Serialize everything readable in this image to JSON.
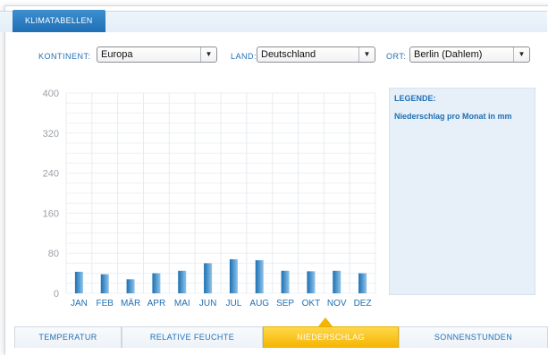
{
  "window": {
    "title_tab": "KLIMATABELLEN"
  },
  "filters": {
    "continent_label": "KONTINENT:",
    "continent_value": "Europa",
    "country_label": "LAND:",
    "country_value": "Deutschland",
    "location_label": "ORT:",
    "location_value": "Berlin (Dahlem)"
  },
  "legend": {
    "title": "LEGENDE:",
    "item": "Niederschlag pro Monat in mm"
  },
  "tabs": [
    {
      "label": "TEMPERATUR",
      "active": false
    },
    {
      "label": "RELATIVE FEUCHTE",
      "active": false
    },
    {
      "label": "NIEDERSCHLAG",
      "active": true
    },
    {
      "label": "SONNENSTUNDEN",
      "active": false
    }
  ],
  "colors": {
    "accent": "#1f6fb4",
    "bar_top": "#1b6fb2",
    "bar_bottom": "#8fc4ea",
    "active_tab": "#f5b400"
  },
  "chart_data": {
    "type": "bar",
    "categories": [
      "JAN",
      "FEB",
      "MÄR",
      "APR",
      "MAI",
      "JUN",
      "JUL",
      "AUG",
      "SEP",
      "OKT",
      "NOV",
      "DEZ"
    ],
    "values": [
      43,
      38,
      28,
      40,
      45,
      60,
      68,
      66,
      45,
      44,
      45,
      40
    ],
    "yticks": [
      "0",
      "80",
      "160",
      "240",
      "320",
      "400"
    ],
    "ylim": [
      0,
      400
    ],
    "grid": true
  }
}
